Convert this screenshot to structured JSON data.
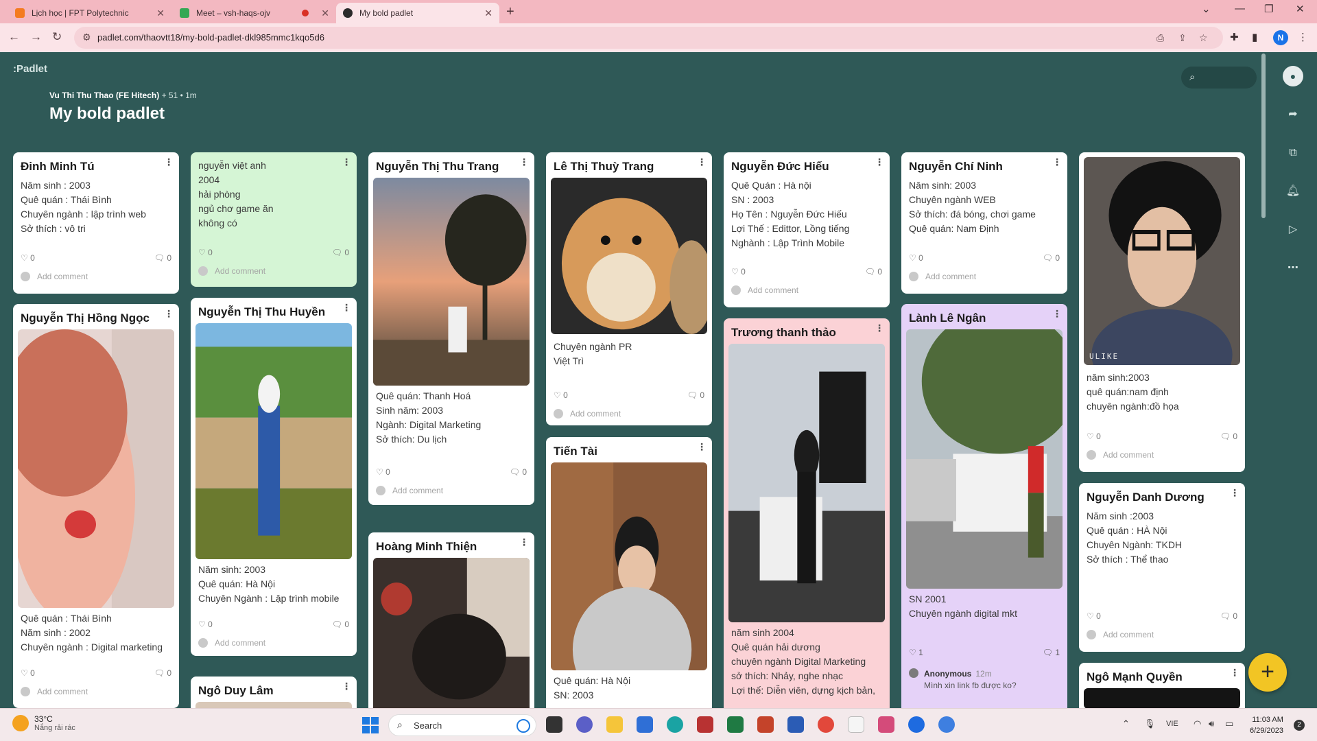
{
  "browser": {
    "tabs": [
      {
        "title": "Lịch học | FPT Polytechnic",
        "active": false
      },
      {
        "title": "Meet – vsh-haqs-ojv",
        "active": false
      },
      {
        "title": "My bold padlet",
        "active": true
      }
    ],
    "url": "padlet.com/thaovtt18/my-bold-padlet-dkl985mmc1kqo5d6",
    "profile_initial": "N"
  },
  "padlet": {
    "logo": ":Padlet",
    "author_name": "Vu Thi Thu Thao (FE Hitech)",
    "author_meta": "+ 51 • 1m",
    "title": "My bold padlet",
    "add_button": "+"
  },
  "posts": [
    {
      "title": "Đinh Minh Tú",
      "lines": [
        "Năm sinh : 2003",
        "Quê quán : Thái Bình",
        "Chuyên ngành : lập trình web",
        "Sở thích : vô tri"
      ],
      "likes": "0",
      "comments": "0",
      "add_comment": "Add comment"
    },
    {
      "title": "",
      "lines": [
        "nguyễn việt anh",
        "2004",
        "hải phòng",
        "ngủ chơ game ăn",
        "không có"
      ],
      "likes": "0",
      "comments": "0",
      "add_comment": "Add comment"
    },
    {
      "title": "Nguyễn Thị Thu Trang",
      "lines": [
        "Quê quán: Thanh Hoá",
        "Sinh năm: 2003",
        "Ngành: Digital Marketing",
        "Sở thích: Du lịch"
      ],
      "likes": "0",
      "comments": "0",
      "add_comment": "Add comment"
    },
    {
      "title": "Lê Thị Thuỳ Trang",
      "lines": [
        "Chuyên ngành PR",
        "Việt Trì"
      ],
      "likes": "0",
      "comments": "0",
      "add_comment": "Add comment"
    },
    {
      "title": "Nguyễn Đức Hiếu",
      "lines": [
        "Quê Quán : Hà  nội",
        "SN : 2003",
        "Họ Tên : Nguyễn Đức Hiếu",
        "Lợi Thế : Edittor, Lồng tiếng",
        "Nghành : Lập Trình Mobile"
      ],
      "likes": "0",
      "comments": "0",
      "add_comment": "Add comment"
    },
    {
      "title": "Nguyễn Chí Ninh",
      "lines": [
        "Năm sinh: 2003",
        "Chuyên ngành WEB",
        "Sở thích: đá bóng, chơi game",
        "Quê quán: Nam Định"
      ],
      "likes": "0",
      "comments": "0",
      "add_comment": "Add comment"
    },
    {
      "title": "",
      "lines": [
        "năm sinh:2003",
        "quê quán:nam định",
        "chuyên ngành:đồ họa"
      ],
      "likes": "0",
      "comments": "0",
      "add_comment": "Add comment"
    },
    {
      "title": "Nguyễn Thị Hồng Ngọc",
      "lines": [
        "Quê quán : Thái Bình",
        "Năm sinh : 2002",
        "Chuyên ngành : Digital marketing"
      ],
      "likes": "0",
      "comments": "0",
      "add_comment": "Add comment"
    },
    {
      "title": "Nguyễn Thị Thu Huyền",
      "lines": [
        "Năm sinh: 2003",
        "Quê quán: Hà Nội",
        "Chuyên Ngành : Lập trình mobile"
      ],
      "likes": "0",
      "comments": "0",
      "add_comment": "Add comment"
    },
    {
      "title": "Hoàng Minh Thiện",
      "lines": []
    },
    {
      "title": "Tiến Tài",
      "lines": [
        "Quê quán: Hà Nội",
        "SN: 2003"
      ]
    },
    {
      "title": "Trương thanh thảo",
      "lines": [
        "năm sinh 2004",
        "Quê quán hải dương",
        "chuyên ngành Digital Marketing",
        "sở thích: Nhảy, nghe nhạc",
        "Lợi thế: Diễn viên, dựng kịch bản,"
      ]
    },
    {
      "title": "Lành Lê Ngân",
      "lines": [
        "SN 2001",
        "Chuyên ngành digital mkt"
      ],
      "likes": "1",
      "comments": "1",
      "comment_author": "Anonymous",
      "comment_time": "12m",
      "comment_text": "Mình xin link fb được ko?"
    },
    {
      "title": "Nguyễn Danh Dương",
      "lines": [
        "Năm sinh :2003",
        "Quê quán : HÀ Nội",
        "Chuyên Ngành: TKDH",
        "Sở thích : Thể thao"
      ],
      "likes": "0",
      "comments": "0",
      "add_comment": "Add comment"
    },
    {
      "title": "Ngô Duy Lâm",
      "lines": []
    },
    {
      "title": "Ngô Mạnh Quyền",
      "lines": []
    }
  ],
  "photo_text": {
    "ulike": "ULIKE"
  },
  "taskbar": {
    "temperature": "33°C",
    "condition": "Nắng rải rác",
    "search": "Search",
    "lang": "VIE",
    "time": "11:03 AM",
    "date": "6/29/2023",
    "notifications": "2"
  }
}
